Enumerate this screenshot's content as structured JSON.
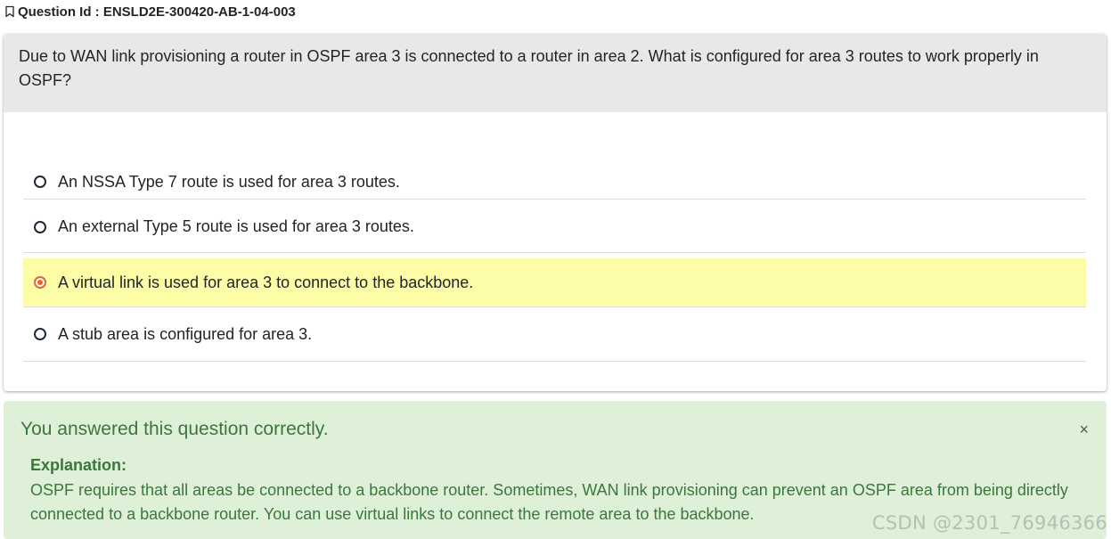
{
  "question": {
    "id_label": "Question Id : ENSLD2E-300420-AB-1-04-003",
    "text": "Due to WAN link provisioning a router in OSPF area 3 is connected to a router in area 2. What is configured for area 3 routes to work properly in OSPF?"
  },
  "options": [
    {
      "text": "An NSSA Type 7 route is used for area 3 routes.",
      "selected": false
    },
    {
      "text": "An external Type 5 route is used for area 3 routes.",
      "selected": false
    },
    {
      "text": "A virtual link is used for area 3 to connect to the backbone.",
      "selected": true
    },
    {
      "text": "A stub area is configured for area 3.",
      "selected": false
    }
  ],
  "feedback": {
    "message": "You answered this question correctly.",
    "close_symbol": "×",
    "explanation_label": "Explanation:",
    "explanation_text": "OSPF requires that all areas be connected to a backbone router. Sometimes, WAN link provisioning can prevent an OSPF area from being directly connected to a backbone router. You can use virtual links to connect the remote area to the backbone."
  },
  "watermark": "CSDN @2301_76946366",
  "icons": {
    "bookmark": "bookmark-icon"
  },
  "colors": {
    "selected_bg": "#fdfda8",
    "radio_checked": "#e8672a",
    "success_bg": "#dff0d8",
    "success_text": "#3c763d",
    "header_bg": "#e8e8e8"
  }
}
